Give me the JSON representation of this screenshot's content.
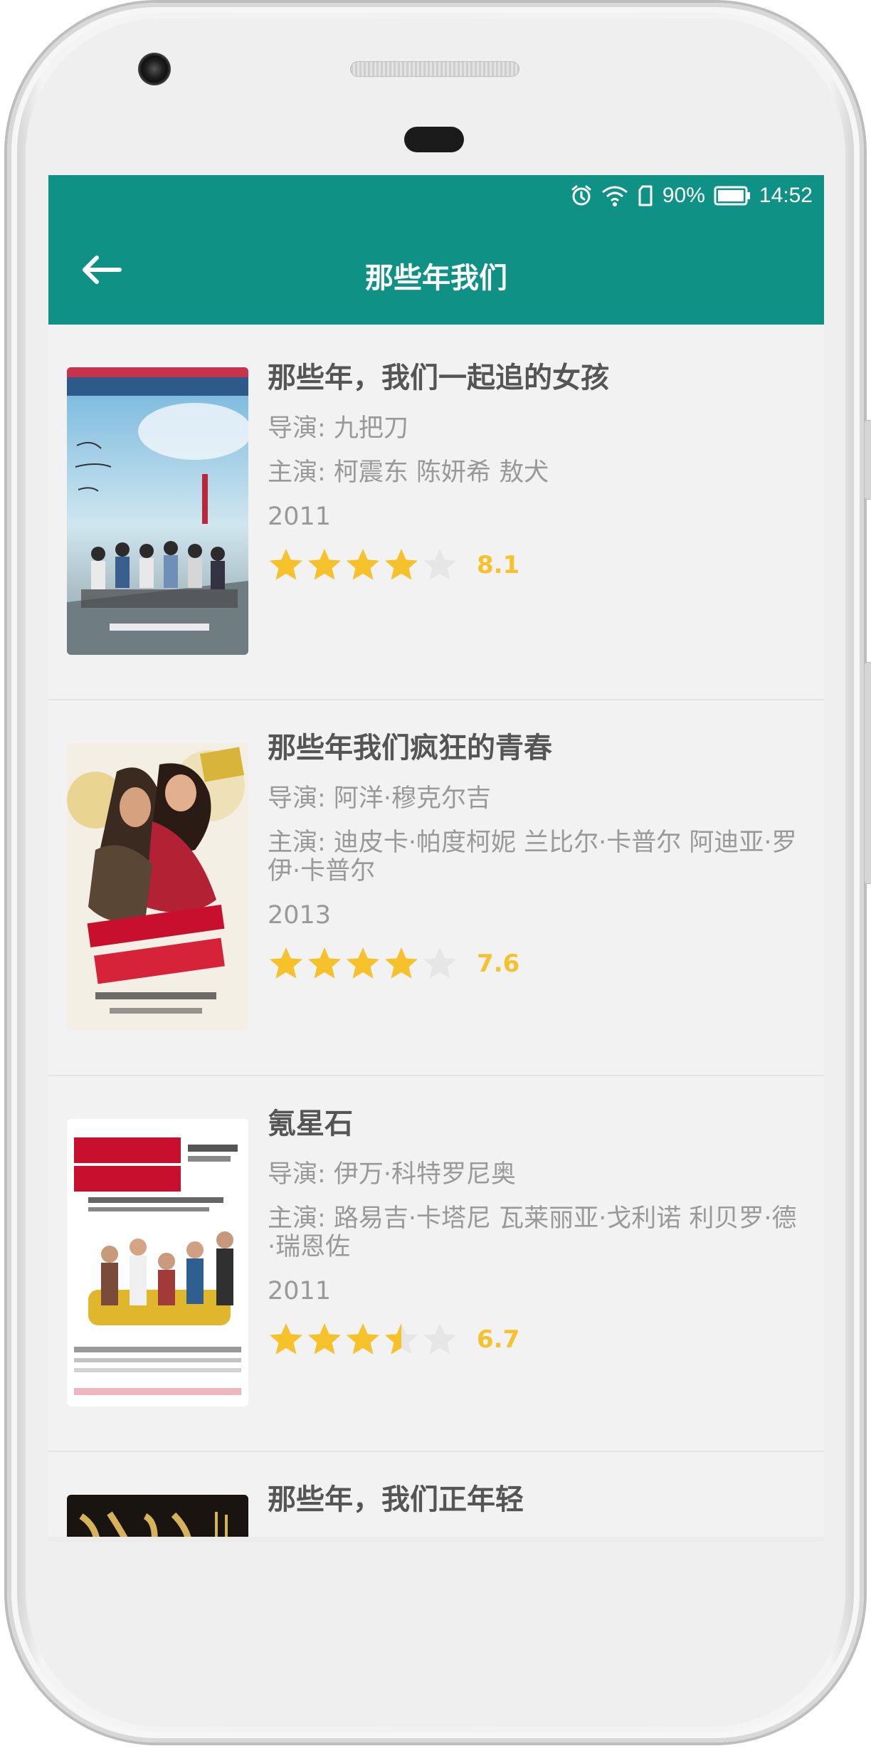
{
  "status_bar": {
    "battery": "90%",
    "time": "14:52"
  },
  "app_bar": {
    "title": "那些年我们",
    "back_icon": "arrow-left-icon"
  },
  "colors": {
    "primary": "#109186",
    "star_filled": "#f6c12a",
    "star_empty": "#e6e6e6",
    "title_text": "#555555",
    "meta_text": "#999999"
  },
  "movies": [
    {
      "title": "那些年，我们一起追的女孩",
      "director": "导演: 九把刀",
      "cast": "主演: 柯震东 陈妍希 敖犬",
      "year": "2011",
      "rating": 8.1,
      "rating_text": "8.1",
      "stars": 4
    },
    {
      "title": "那些年我们疯狂的青春",
      "director": "导演: 阿洋·穆克尔吉",
      "cast": "主演: 迪皮卡·帕度柯妮 兰比尔·卡普尔 阿迪亚·罗伊·卡普尔",
      "year": "2013",
      "rating": 7.6,
      "rating_text": "7.6",
      "stars": 4
    },
    {
      "title": "氪星石",
      "director": "导演: 伊万·科特罗尼奥",
      "cast": "主演: 路易吉·卡塔尼 瓦莱丽亚·戈利诺 利贝罗·德·瑞恩佐",
      "year": "2011",
      "rating": 6.7,
      "rating_text": "6.7",
      "stars": 3.5
    },
    {
      "title": "那些年，我们正年轻"
    }
  ]
}
